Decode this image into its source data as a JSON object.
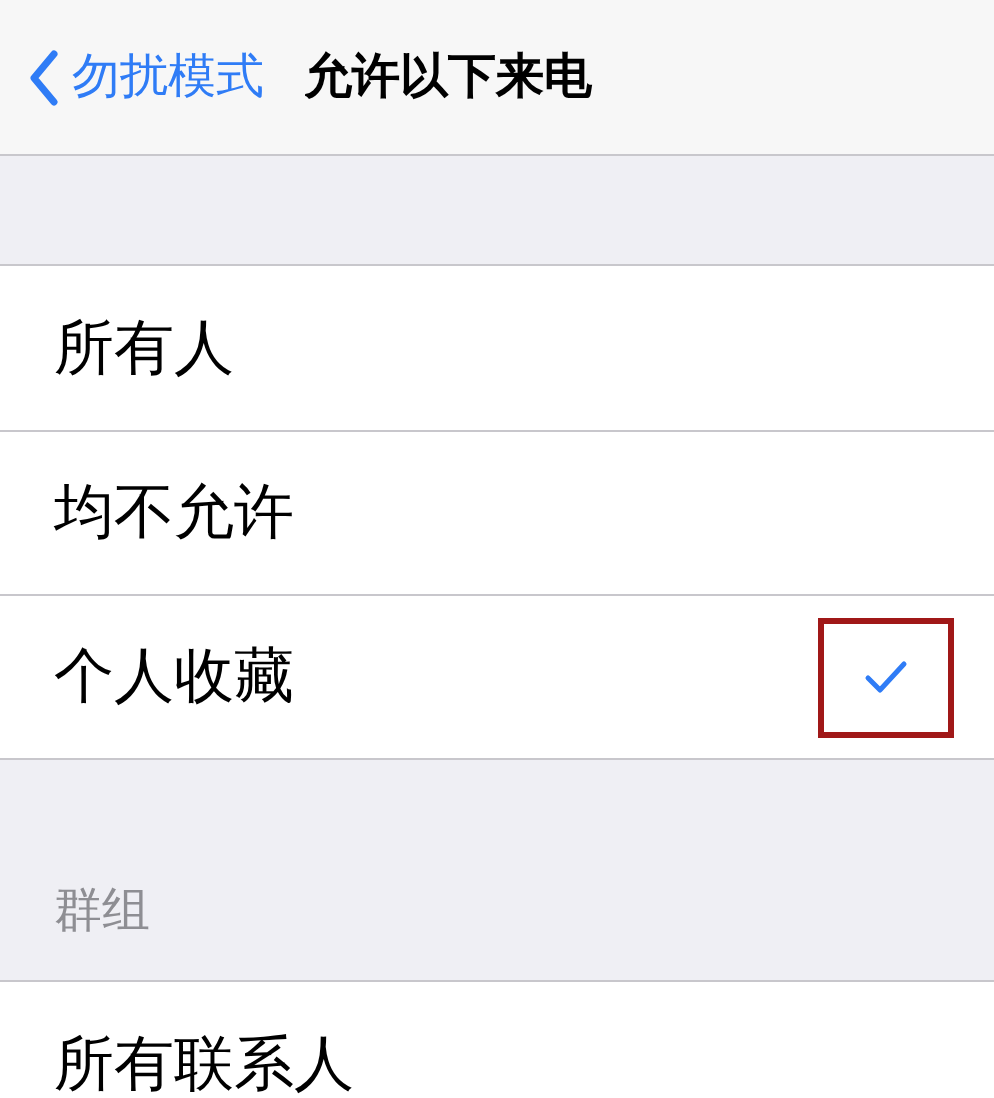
{
  "nav": {
    "back_label": "勿扰模式",
    "title": "允许以下来电"
  },
  "options": [
    {
      "label": "所有人",
      "selected": false,
      "highlighted": false
    },
    {
      "label": "均不允许",
      "selected": false,
      "highlighted": false
    },
    {
      "label": "个人收藏",
      "selected": true,
      "highlighted": true
    }
  ],
  "groups": {
    "header": "群组",
    "rows": [
      {
        "label": "所有联系人"
      }
    ]
  }
}
